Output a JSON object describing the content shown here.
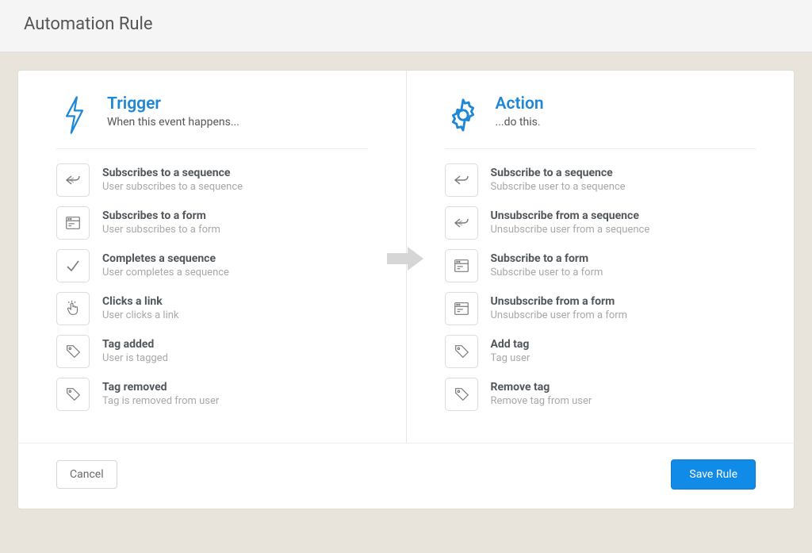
{
  "header": {
    "title": "Automation Rule"
  },
  "trigger": {
    "title": "Trigger",
    "subtitle": "When this event happens...",
    "options": [
      {
        "title": "Subscribes to a sequence",
        "sub": "User subscribes to a sequence"
      },
      {
        "title": "Subscribes to a form",
        "sub": "User subscribes to a form"
      },
      {
        "title": "Completes a sequence",
        "sub": "User completes a sequence"
      },
      {
        "title": "Clicks a link",
        "sub": "User clicks a link"
      },
      {
        "title": "Tag added",
        "sub": "User is tagged"
      },
      {
        "title": "Tag removed",
        "sub": "Tag is removed from user"
      }
    ]
  },
  "action": {
    "title": "Action",
    "subtitle": "...do this.",
    "options": [
      {
        "title": "Subscribe to a sequence",
        "sub": "Subscribe user to a sequence"
      },
      {
        "title": "Unsubscribe from a sequence",
        "sub": "Unsubscribe user from a sequence"
      },
      {
        "title": "Subscribe to a form",
        "sub": "Subscribe user to a form"
      },
      {
        "title": "Unsubscribe from a form",
        "sub": "Unsubscribe user from a form"
      },
      {
        "title": "Add tag",
        "sub": "Tag user"
      },
      {
        "title": "Remove tag",
        "sub": "Remove tag from user"
      }
    ]
  },
  "footer": {
    "cancel": "Cancel",
    "save": "Save Rule"
  }
}
